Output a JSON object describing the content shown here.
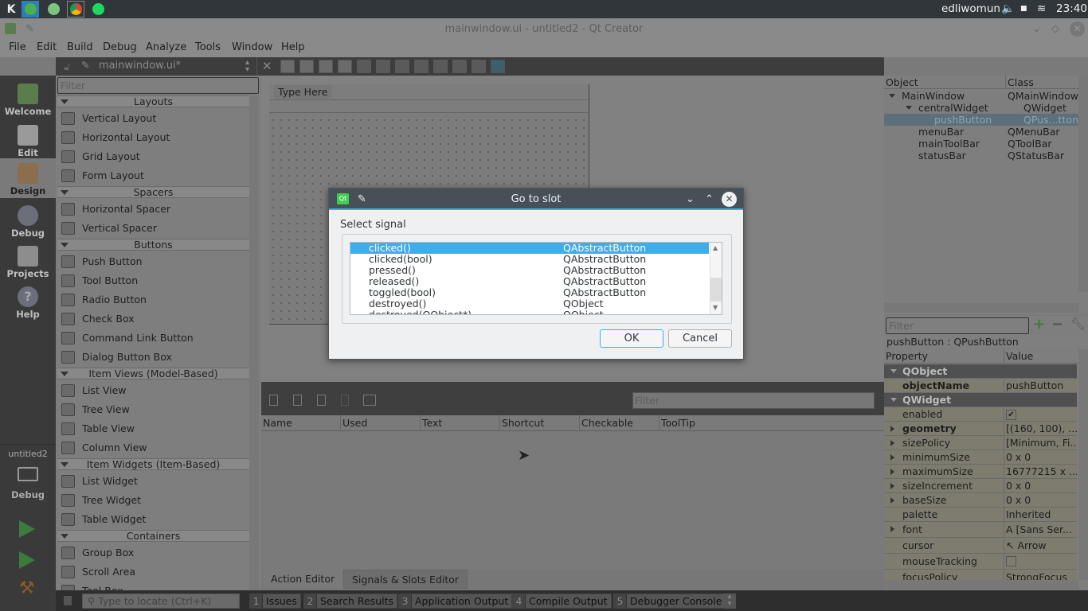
{
  "taskbar": {
    "apps": [
      "kde-menu-icon",
      "hangouts-icon",
      "app-icon",
      "chrome-icon",
      "spotify-icon"
    ],
    "user": "edliwomun",
    "clock": "23:40"
  },
  "window": {
    "title": "mainwindow.ui - untitled2 - Qt Creator"
  },
  "menubar": [
    "File",
    "Edit",
    "Build",
    "Debug",
    "Analyze",
    "Tools",
    "Window",
    "Help"
  ],
  "editor": {
    "filename": "mainwindow.ui*"
  },
  "modes": [
    {
      "label": "Welcome",
      "icon": "qt-logo-icon"
    },
    {
      "label": "Edit",
      "icon": "edit-document-icon"
    },
    {
      "label": "Design",
      "icon": "design-brush-icon"
    },
    {
      "label": "Debug",
      "icon": "bug-icon"
    },
    {
      "label": "Projects",
      "icon": "projects-folder-icon"
    },
    {
      "label": "Help",
      "icon": "help-icon"
    }
  ],
  "kit": {
    "project": "untitled2",
    "mode": "Debug"
  },
  "widgetbox": {
    "filter_placeholder": "Filter",
    "sections": [
      {
        "title": "Layouts",
        "items": [
          "Vertical Layout",
          "Horizontal Layout",
          "Grid Layout",
          "Form Layout"
        ]
      },
      {
        "title": "Spacers",
        "items": [
          "Horizontal Spacer",
          "Vertical Spacer"
        ]
      },
      {
        "title": "Buttons",
        "items": [
          "Push Button",
          "Tool Button",
          "Radio Button",
          "Check Box",
          "Command Link Button",
          "Dialog Button Box"
        ]
      },
      {
        "title": "Item Views (Model-Based)",
        "items": [
          "List View",
          "Tree View",
          "Table View",
          "Column View"
        ]
      },
      {
        "title": "Item Widgets (Item-Based)",
        "items": [
          "List Widget",
          "Tree Widget",
          "Table Widget"
        ]
      },
      {
        "title": "Containers",
        "items": [
          "Group Box",
          "Scroll Area",
          "Tool Box"
        ]
      }
    ]
  },
  "form": {
    "menu_placeholder": "Type Here"
  },
  "action_editor": {
    "filter_placeholder": "Filter",
    "columns": [
      "Name",
      "Used",
      "Text",
      "Shortcut",
      "Checkable",
      "ToolTip"
    ],
    "tabs": [
      "Action Editor",
      "Signals & Slots Editor"
    ]
  },
  "object_inspector": {
    "columns": [
      "Object",
      "Class"
    ],
    "rows": [
      {
        "object": "MainWindow",
        "class": "QMainWindow"
      },
      {
        "object": "centralWidget",
        "class": "QWidget"
      },
      {
        "object": "pushButton",
        "class": "QPus...tton"
      },
      {
        "object": "menuBar",
        "class": "QMenuBar"
      },
      {
        "object": "mainToolBar",
        "class": "QToolBar"
      },
      {
        "object": "statusBar",
        "class": "QStatusBar"
      }
    ]
  },
  "property_editor": {
    "filter_placeholder": "Filter",
    "object_label": "pushButton : QPushButton",
    "columns": [
      "Property",
      "Value"
    ],
    "rows": [
      {
        "key": "QObject",
        "group": true
      },
      {
        "key": "objectName",
        "value": "pushButton",
        "bold": true
      },
      {
        "key": "QWidget",
        "group": true
      },
      {
        "key": "enabled",
        "value": "✔"
      },
      {
        "key": "geometry",
        "value": "[(160, 100), ...",
        "bold": true,
        "expand": true
      },
      {
        "key": "sizePolicy",
        "value": "[Minimum, Fi...",
        "expand": true
      },
      {
        "key": "minimumSize",
        "value": "0 x 0",
        "expand": true
      },
      {
        "key": "maximumSize",
        "value": "16777215 x ...",
        "expand": true
      },
      {
        "key": "sizeIncrement",
        "value": "0 x 0",
        "expand": true
      },
      {
        "key": "baseSize",
        "value": "0 x 0",
        "expand": true
      },
      {
        "key": "palette",
        "value": "Inherited"
      },
      {
        "key": "font",
        "value": "A  [Sans Ser...",
        "expand": true
      },
      {
        "key": "cursor",
        "value": "↖  Arrow"
      },
      {
        "key": "mouseTracking",
        "value": ""
      },
      {
        "key": "focusPolicy",
        "value": "StrongFocus"
      }
    ]
  },
  "statusbar": {
    "locate_placeholder": "Type to locate (Ctrl+K)",
    "panes": [
      {
        "num": "1",
        "label": "Issues"
      },
      {
        "num": "2",
        "label": "Search Results"
      },
      {
        "num": "3",
        "label": "Application Output"
      },
      {
        "num": "4",
        "label": "Compile Output"
      },
      {
        "num": "5",
        "label": "Debugger Console"
      }
    ]
  },
  "dialog": {
    "title": "Go to slot",
    "prompt": "Select signal",
    "signals": [
      {
        "name": "clicked()",
        "class": "QAbstractButton",
        "selected": true
      },
      {
        "name": "clicked(bool)",
        "class": "QAbstractButton"
      },
      {
        "name": "pressed()",
        "class": "QAbstractButton"
      },
      {
        "name": "released()",
        "class": "QAbstractButton"
      },
      {
        "name": "toggled(bool)",
        "class": "QAbstractButton"
      },
      {
        "name": "destroyed()",
        "class": "QObject"
      },
      {
        "name": "destroyed(QObject*)",
        "class": "QObject"
      }
    ],
    "ok": "OK",
    "cancel": "Cancel"
  }
}
